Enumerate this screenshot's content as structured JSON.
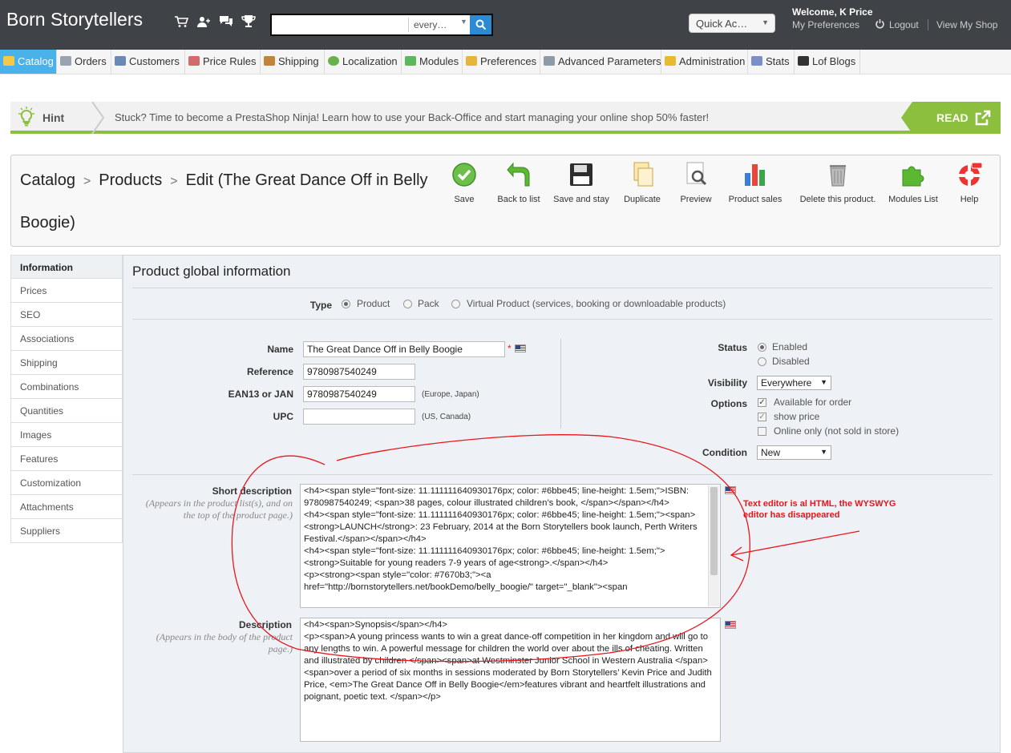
{
  "header": {
    "shop_name": "Born Storytellers",
    "search": {
      "value": "",
      "placeholder": "",
      "scope": "every…"
    },
    "quick_access": "Quick Ac…",
    "welcome_prefix": "Welcome, ",
    "welcome_name": "K Price",
    "my_preferences": "My Preferences",
    "logout": "Logout",
    "view_my_shop": "View My Shop",
    "icons": [
      "cart-icon",
      "customers-icon",
      "messages-icon",
      "trophy-icon",
      "search-icon"
    ]
  },
  "nav": {
    "items": [
      {
        "label": "Catalog"
      },
      {
        "label": "Orders"
      },
      {
        "label": "Customers"
      },
      {
        "label": "Price Rules"
      },
      {
        "label": "Shipping"
      },
      {
        "label": "Localization"
      },
      {
        "label": "Modules"
      },
      {
        "label": "Preferences"
      },
      {
        "label": "Advanced Parameters"
      },
      {
        "label": "Administration"
      },
      {
        "label": "Stats"
      },
      {
        "label": "Lof Blogs"
      }
    ]
  },
  "hint": {
    "label": "Hint",
    "text": "Stuck? Time to become a PrestaShop Ninja! Learn how to use your Back-Office and start managing your online shop 50% faster!",
    "read": "READ"
  },
  "toolbar": {
    "breadcrumb": {
      "catalog": "Catalog",
      "products": "Products",
      "edit_line1": "Edit (The Great Dance Off in Belly",
      "edit_line2": "Boogie)"
    },
    "buttons": {
      "save": "Save",
      "back": "Back to list",
      "save_stay": "Save and stay",
      "duplicate": "Duplicate",
      "preview": "Preview",
      "sales": "Product sales",
      "delete": "Delete this product.",
      "modules": "Modules List",
      "help": "Help"
    }
  },
  "tabs": [
    "Information",
    "Prices",
    "SEO",
    "Associations",
    "Shipping",
    "Combinations",
    "Quantities",
    "Images",
    "Features",
    "Customization",
    "Attachments",
    "Suppliers"
  ],
  "form": {
    "title": "Product global information",
    "type": {
      "label": "Type",
      "options": [
        "Product",
        "Pack",
        "Virtual Product (services, booking or downloadable products)"
      ],
      "selected": "Product"
    },
    "name": {
      "label": "Name",
      "value": "The Great Dance Off in Belly Boogie",
      "required": "*"
    },
    "reference": {
      "label": "Reference",
      "value": "9780987540249"
    },
    "ean13": {
      "label": "EAN13 or JAN",
      "value": "9780987540249",
      "hint": "(Europe, Japan)"
    },
    "upc": {
      "label": "UPC",
      "value": "",
      "hint": "(US, Canada)"
    },
    "status": {
      "label": "Status",
      "enabled": "Enabled",
      "disabled": "Disabled",
      "selected": "Enabled"
    },
    "visibility": {
      "label": "Visibility",
      "value": "Everywhere"
    },
    "options": {
      "label": "Options",
      "available": "Available for order",
      "show_price": "show price",
      "online_only": "Online only (not sold in store)"
    },
    "condition": {
      "label": "Condition",
      "value": "New"
    },
    "short_description": {
      "label": "Short description",
      "help": "(Appears in the product list(s), and on the top of the product page.)",
      "value": "<h4><span style=\"font-size: 11.111111640930176px; color: #6bbe45; line-height: 1.5em;\">ISBN: 9780987540249; <span>38 pages, colour illustrated children’s book, </span></span></h4>\n<h4><span style=\"font-size: 11.111111640930176px; color: #6bbe45; line-height: 1.5em;\"><span><strong>LAUNCH</strong>: 23 February, 2014 at the Born Storytellers book launch, Perth Writers Festival.</span></span></h4>\n<h4><span style=\"font-size: 11.111111640930176px; color: #6bbe45; line-height: 1.5em;\"><strong>Suitable for young readers 7-9 years of age<strong>.</span></h4>\n<p><strong><span style=\"color: #7670b3;\"><a href=\"http://bornstorytellers.net/bookDemo/belly_boogie/\" target=\"_blank\"><span"
    },
    "description": {
      "label": "Description",
      "help": "(Appears in the body of the product page.)",
      "value": "<h4><span>Synopsis</span></h4>\n<p><span>A young princess wants to win a great dance-off competition in her kingdom and will go to any lengths to win. A powerful message for children the world over about the ills of cheating. Written and illustrated by children </span><span>at Westminster Junior School in Western Australia </span><span>over a period of six months in sessions moderated by Born Storytellers’ Kevin Price and Judith Price, <em>The Great Dance Off in Belly Boogie</em>features vibrant and heartfelt illustrations and poignant, poetic text. </span></p>"
    }
  },
  "annotation": "Text editor is al HTML, the WYSWYG editor has disappeared",
  "colors": {
    "header_bg": "#3f4247",
    "nav_active": "#49b2e9",
    "hint_green": "#8cbf3e",
    "annotation_red": "#e8161b",
    "search_btn": "#2a8ad4"
  }
}
